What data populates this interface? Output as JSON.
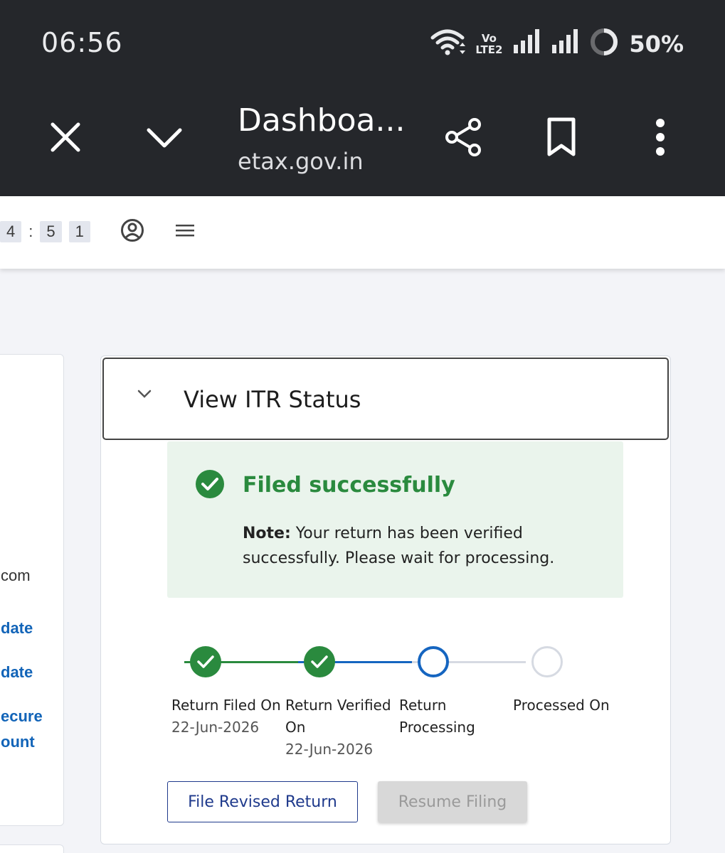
{
  "status_bar": {
    "time": "06:56",
    "volte_top": "Vo",
    "volte_bottom": "LTE2",
    "battery": "50%"
  },
  "browser": {
    "title": "Dashboa...",
    "url": "etax.gov.in",
    "icons": [
      "close-icon",
      "chevron-down-icon",
      "share-icon",
      "bookmark-icon",
      "more-vert-icon"
    ]
  },
  "site_header": {
    "timer": [
      "4",
      ":",
      "5",
      "1"
    ],
    "icons": [
      "user-circle-icon",
      "hamburger-menu-icon"
    ]
  },
  "left_card": {
    "email_fragment": "com",
    "link_1": "date",
    "link_2": "date",
    "link_3a": "ecure",
    "link_3b": "ount"
  },
  "itr_status": {
    "heading": "View ITR Status",
    "success_title": "Filed successfully",
    "note_label": "Note:",
    "note_text": " Your return has been verified successfully. Please wait for processing.",
    "steps": [
      {
        "label": "Return Filed On",
        "date": "22-Jun-2026",
        "state": "done"
      },
      {
        "label": "Return Verified On",
        "date": "22-Jun-2026",
        "state": "done"
      },
      {
        "label": "Return Processing",
        "date": "",
        "state": "current"
      },
      {
        "label": "Processed On",
        "date": "",
        "state": "pending"
      }
    ],
    "buttons": {
      "file_revised": "File Revised Return",
      "resume": "Resume Filing"
    }
  },
  "colors": {
    "dark_chrome": "#25272b",
    "success_green": "#2a8a3e",
    "progress_blue": "#1565c0",
    "link_blue": "#1264b8",
    "button_navy": "#1f3a8c"
  }
}
